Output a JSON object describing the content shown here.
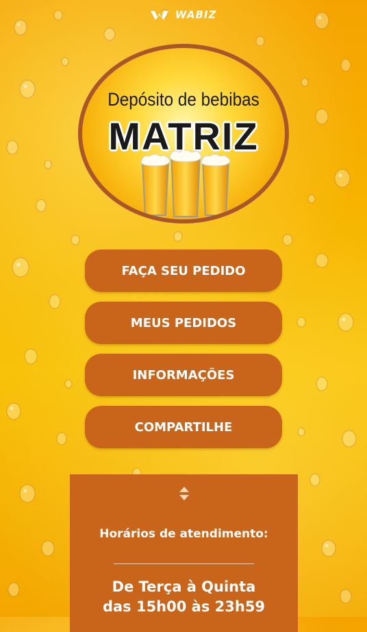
{
  "brand": {
    "name": "WABIZ"
  },
  "logo": {
    "subtitle": "Depósito de bebibas",
    "title": "MATRIZ"
  },
  "menu": {
    "items": [
      {
        "label": "FAÇA SEU PEDIDO"
      },
      {
        "label": "MEUS PEDIDOS"
      },
      {
        "label": "INFORMAÇÕES"
      },
      {
        "label": "COMPARTILHE"
      }
    ]
  },
  "hours": {
    "title": "Horários de atendimento:",
    "days": "De Terça à Quinta",
    "time": "das 15h00 às 23h59"
  },
  "colors": {
    "button": "#c8651b",
    "logo_border": "#a9562b",
    "background": "#f7b400"
  }
}
